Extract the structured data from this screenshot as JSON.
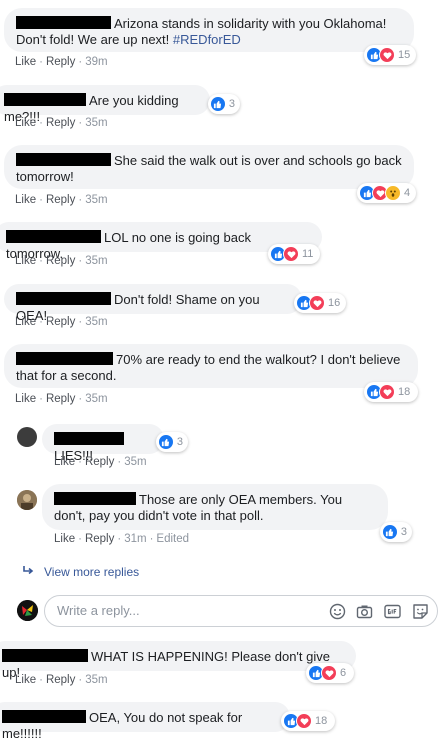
{
  "actions": {
    "like": "Like",
    "reply": "Reply",
    "dot": "·"
  },
  "colors": {
    "like_blue": "#1877f2",
    "love_red": "#f33e58",
    "wow_yellow": "#f7b928",
    "link": "#385898",
    "bubble": "#f2f3f5"
  },
  "comments": [
    {
      "text": "Arizona stands in solidarity with you Oklahoma! Don't fold! We are up next! ",
      "hashtag": "#REDforED",
      "time": "39m",
      "reactions": [
        "like",
        "love"
      ],
      "count": "15"
    },
    {
      "text": "Are you kidding me?!!!",
      "time": "35m",
      "reactions": [
        "like"
      ],
      "count": "3"
    },
    {
      "text": "She said the walk out is over and schools go back tomorrow!",
      "time": "35m",
      "reactions": [
        "like",
        "love",
        "wow"
      ],
      "count": "4"
    },
    {
      "text": "LOL no one is going back tomorrow.",
      "time": "35m",
      "reactions": [
        "like",
        "love"
      ],
      "count": "11"
    },
    {
      "text": "Don't fold! Shame on you OEA!",
      "time": "35m",
      "reactions": [
        "like",
        "love"
      ],
      "count": "16"
    },
    {
      "text": "70% are ready to end the walkout? I don't believe that for a second.",
      "time": "35m",
      "reactions": [
        "like",
        "love"
      ],
      "count": "18"
    },
    {
      "text": "LIES!!!",
      "time": "35m",
      "reactions": [
        "like"
      ],
      "count": "3"
    },
    {
      "text": "Those are only OEA members. You don't, pay you didn't vote in that poll.",
      "time": "31m",
      "edited": "Edited",
      "reactions": [
        "like"
      ],
      "count": "3"
    },
    {
      "text": "WHAT IS HAPPENING! Please don't give up!",
      "time": "35m",
      "reactions": [
        "like",
        "love"
      ],
      "count": "6"
    },
    {
      "text": "OEA, You do not speak for me!!!!!!",
      "reactions": [
        "like",
        "love"
      ],
      "count": "18"
    }
  ],
  "view_more_replies": "View more replies",
  "reply_box": {
    "placeholder": "Write a reply..."
  },
  "icons": [
    "emoji-icon",
    "camera-icon",
    "gif-icon",
    "sticker-icon"
  ]
}
